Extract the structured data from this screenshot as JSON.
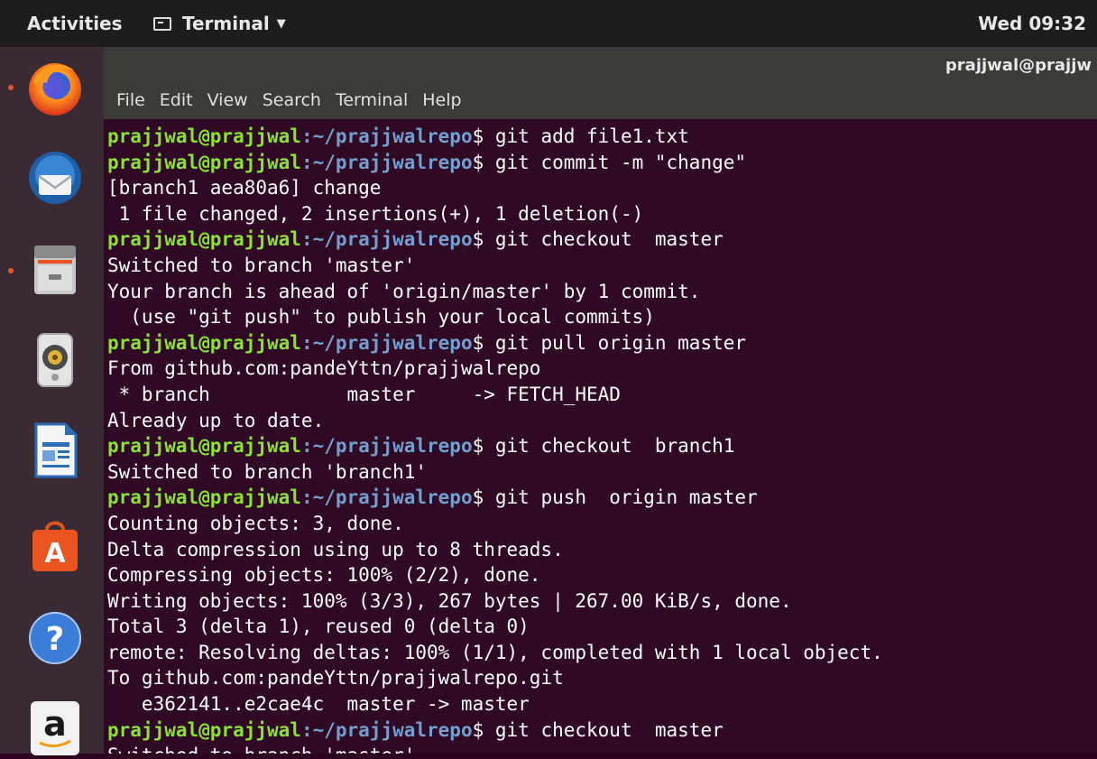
{
  "topbar": {
    "activities": "Activities",
    "app_name": "Terminal",
    "clock": "Wed 09:32"
  },
  "window": {
    "title": "prajjwal@prajjw",
    "menu": [
      "File",
      "Edit",
      "View",
      "Search",
      "Terminal",
      "Help"
    ]
  },
  "dock": {
    "items": [
      {
        "name": "firefox-icon",
        "running": true
      },
      {
        "name": "thunderbird-icon",
        "running": false
      },
      {
        "name": "files-icon",
        "running": true
      },
      {
        "name": "rhythmbox-icon",
        "running": false
      },
      {
        "name": "libreoffice-writer-icon",
        "running": false
      },
      {
        "name": "software-center-icon",
        "running": false
      },
      {
        "name": "help-icon",
        "running": false
      },
      {
        "name": "amazon-icon",
        "running": false
      }
    ]
  },
  "terminal": {
    "prompt_user": "prajjwal@prajjwal",
    "prompt_path": ":~/prajjwalrepo",
    "lines": [
      {
        "type": "prompt",
        "cmd": "$ git add file1.txt"
      },
      {
        "type": "prompt",
        "cmd": "$ git commit -m \"change\""
      },
      {
        "type": "text",
        "text": "[branch1 aea80a6] change"
      },
      {
        "type": "text",
        "text": " 1 file changed, 2 insertions(+), 1 deletion(-)"
      },
      {
        "type": "prompt",
        "cmd": "$ git checkout  master"
      },
      {
        "type": "text",
        "text": "Switched to branch 'master'"
      },
      {
        "type": "text",
        "text": "Your branch is ahead of 'origin/master' by 1 commit."
      },
      {
        "type": "text",
        "text": "  (use \"git push\" to publish your local commits)"
      },
      {
        "type": "prompt",
        "cmd": "$ git pull origin master"
      },
      {
        "type": "text",
        "text": "From github.com:pandeYttn/prajjwalrepo"
      },
      {
        "type": "text",
        "text": " * branch            master     -> FETCH_HEAD"
      },
      {
        "type": "text",
        "text": "Already up to date."
      },
      {
        "type": "prompt",
        "cmd": "$ git checkout  branch1"
      },
      {
        "type": "text",
        "text": "Switched to branch 'branch1'"
      },
      {
        "type": "prompt",
        "cmd": "$ git push  origin master"
      },
      {
        "type": "text",
        "text": "Counting objects: 3, done."
      },
      {
        "type": "text",
        "text": "Delta compression using up to 8 threads."
      },
      {
        "type": "text",
        "text": "Compressing objects: 100% (2/2), done."
      },
      {
        "type": "text",
        "text": "Writing objects: 100% (3/3), 267 bytes | 267.00 KiB/s, done."
      },
      {
        "type": "text",
        "text": "Total 3 (delta 1), reused 0 (delta 0)"
      },
      {
        "type": "text",
        "text": "remote: Resolving deltas: 100% (1/1), completed with 1 local object."
      },
      {
        "type": "text",
        "text": "To github.com:pandeYttn/prajjwalrepo.git"
      },
      {
        "type": "text",
        "text": "   e362141..e2cae4c  master -> master"
      },
      {
        "type": "prompt",
        "cmd": "$ git checkout  master"
      },
      {
        "type": "text",
        "text": "Switched to branch 'master'"
      }
    ]
  },
  "colors": {
    "terminal_bg": "#300a24",
    "prompt_user": "#8ae234",
    "prompt_path": "#729fcf",
    "accent": "#e95420"
  }
}
